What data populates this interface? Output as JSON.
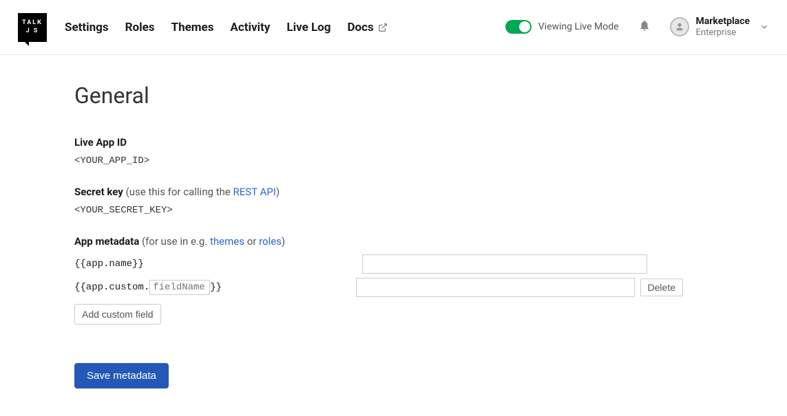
{
  "logo": {
    "line1": "TALK",
    "line2": "J S"
  },
  "nav": {
    "settings": "Settings",
    "roles": "Roles",
    "themes": "Themes",
    "activity": "Activity",
    "livelog": "Live Log",
    "docs": "Docs"
  },
  "header": {
    "toggle_label": "Viewing Live Mode",
    "account_name": "Marketplace",
    "account_tier": "Enterprise"
  },
  "general": {
    "title": "General",
    "live_app_id_label": "Live App ID",
    "live_app_id_value": "<YOUR_APP_ID>",
    "secret_key_label": "Secret key",
    "secret_key_hint_pre": " (use this for calling the ",
    "secret_key_link": "REST API",
    "secret_key_hint_post": ")",
    "secret_key_value": "<YOUR_SECRET_KEY>",
    "metadata_label": "App metadata",
    "metadata_hint_pre": " (for use in e.g. ",
    "metadata_link_themes": "themes",
    "metadata_hint_or": " or ",
    "metadata_link_roles": "roles",
    "metadata_hint_post": ")",
    "metadata_row1_key": "{{app.name}}",
    "metadata_row2_prefix": "{{app.custom.",
    "metadata_row2_placeholder": "fieldName",
    "metadata_row2_suffix": "}}",
    "delete_btn": "Delete",
    "add_field_btn": "Add custom field",
    "save_btn": "Save metadata"
  }
}
